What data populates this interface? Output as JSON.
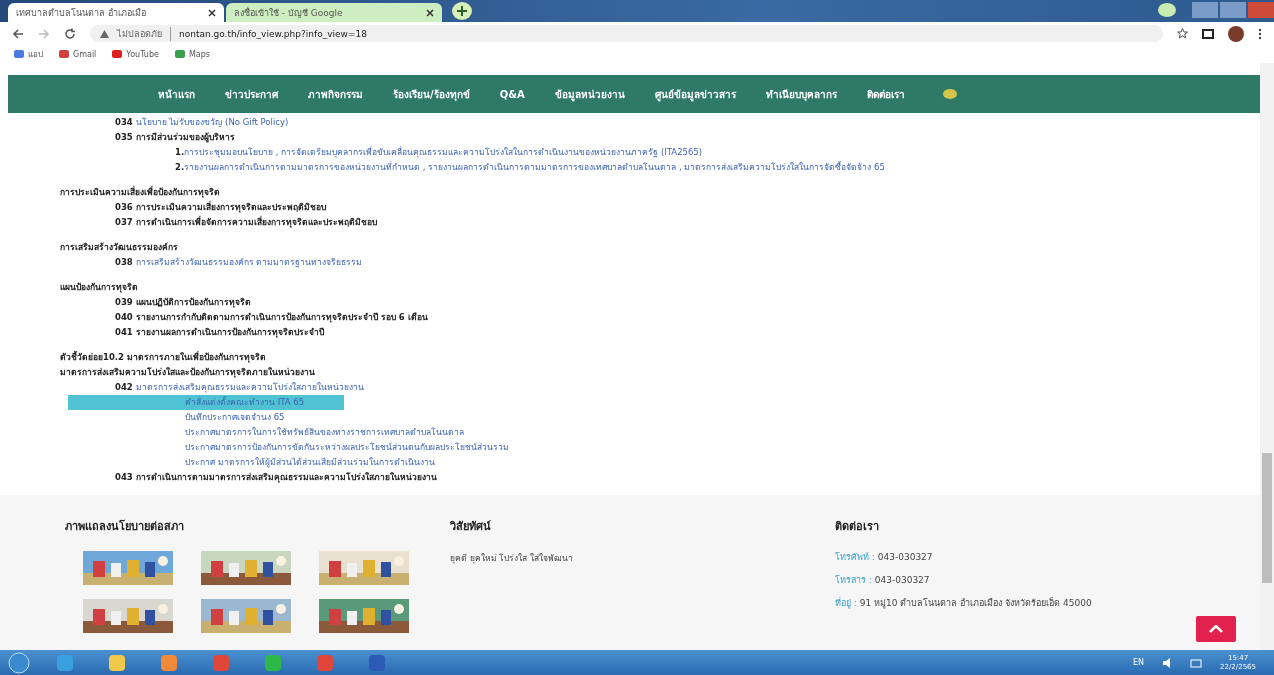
{
  "browser": {
    "tabs": [
      {
        "title": "เทศบาลตำบลโนนตาล อำเภอเมือ",
        "selected": true
      },
      {
        "title": "ลงชื่อเข้าใช้ - บัญชี Google",
        "selected": false
      }
    ],
    "security": "ไม่ปลอดภัย",
    "url": "nontan.go.th/info_view.php?info_view=18",
    "bookmarks": [
      {
        "label": "แอป",
        "kind": "apps"
      },
      {
        "label": "Gmail",
        "kind": "gmail"
      },
      {
        "label": "YouTube",
        "kind": "youtube"
      },
      {
        "label": "Maps",
        "kind": "maps"
      }
    ]
  },
  "nav": [
    "หน้าแรก",
    "ข่าวประกาศ",
    "ภาพกิจกรรม",
    "ร้องเรียน/ร้องทุกข์",
    "Q&A",
    "ข้อมูลหน่วยงาน",
    "ศูนย์ข้อมูลข่าวสาร",
    "ทำเนียบบุคลากร",
    "ติดต่อเรา"
  ],
  "sections": [
    {
      "items": [
        {
          "code": "034",
          "text": "นโยบาย ไม่รับของขวัญ (No Gift Policy)",
          "link": true
        },
        {
          "code": "035",
          "text": "การมีส่วนร่วมของผู้บริหาร",
          "link": false,
          "numbered": [
            {
              "num": "1.",
              "text": "การประชุมมอบนโยบาย , การจัดเตรียมบุคลากรเพื่อขับเคลื่อนคุณธรรมและความโปร่งใสในการดำเนินงานของหน่วยงานภาครัฐ (ITA2565)"
            },
            {
              "num": "2.",
              "text": "รายงานผลการดำเนินการตามมาตรการของหน่วยงานที่กำหนด , รายงานผลการดำเนินการตามมาตรการของเทศบาลตำบลโนนตาล , มาตรการส่งเสริมความโปร่งใสในการจัดซื้อจัดจ้าง 65"
            }
          ]
        }
      ]
    },
    {
      "heading": "การประเมินความเสี่ยงเพื่อป้องกันการทุจริต",
      "items": [
        {
          "code": "036",
          "text": "การประเมินความเสี่ยงการทุจริตและประพฤติมิชอบ",
          "link": false
        },
        {
          "code": "037",
          "text": "การดำเนินการเพื่อจัดการความเสี่ยงการทุจริตและประพฤติมิชอบ",
          "link": false
        }
      ]
    },
    {
      "heading": "การเสริมสร้างวัฒนธรรมองค์กร",
      "items": [
        {
          "code": "038",
          "text": "การเสริมสร้างวัฒนธรรมองค์กร ตามมาตรฐานทางจริยธรรม",
          "link": true
        }
      ]
    },
    {
      "heading": "แผนป้องกันการทุจริต",
      "items": [
        {
          "code": "039",
          "text": "แผนปฏิบัติการป้องกันการทุจริต",
          "link": false
        },
        {
          "code": "040",
          "text": "รายงานการกำกับติดตามการดำเนินการป้องกันการทุจริตประจำปี รอบ 6 เดือน",
          "link": false
        },
        {
          "code": "041",
          "text": "รายงานผลการดำเนินการป้องกันการทุจริตประจำปี",
          "link": false
        }
      ]
    },
    {
      "heading": "ตัวชี้วัดย่อย10.2 มาตรการภายในเพื่อป้องกันการทุจริต",
      "subheading": "มาตรการส่งเสริมความโปร่งใสและป้องกันการทุจริตภายในหน่วยงาน",
      "items": [
        {
          "code": "042",
          "text": "มาตรการส่งเสริมคุณธรรมและความโปร่งใสภายในหน่วยงาน",
          "link": true,
          "links": [
            {
              "text": "คำสั่งแต่งตั้งคณะทำงาน ITA 65",
              "selected": true
            },
            {
              "text": "บันทึกประกาศเจตจำนง 65",
              "selected": false
            },
            {
              "text": "ประกาศมาตรการในการใช้ทรัพย์สินของทางราชการเทศบาลตำบลโนนตาล",
              "selected": false
            },
            {
              "text": "ประกาศมาตรการป้องกันการขัดกันระหว่างผลประโยชน์ส่วนตนกับผลประโยชน์ส่วนรวม",
              "selected": false
            },
            {
              "text": "ประกาศ มาตรการให้ผู้มีส่วนได้ส่วนเสียมีส่วนร่วมในการดำเนินงาน",
              "selected": false
            }
          ]
        },
        {
          "code": "043",
          "text": "การดำเนินการตามมาตรการส่งเสริมคุณธรรมและความโปร่งใสภายในหน่วยงาน",
          "link": false
        }
      ]
    }
  ],
  "footer": {
    "gallery": {
      "title": "ภาพแถลงนโยบายต่อสภา"
    },
    "vision": {
      "title": "วิสัยทัศน์",
      "text": "ยุคดี ยุคใหม่ โปร่งใส ใส่ใจพัฒนา"
    },
    "contact": {
      "title": "ติดต่อเรา",
      "lines": [
        {
          "label": "โทรศัพท์ :",
          "value": "043-030327"
        },
        {
          "label": "โทรสาร :",
          "value": "043-030327"
        },
        {
          "label": "ที่อยู่ :",
          "value": "91 หมู่10 ตำบลโนนตาล อำเภอเมือง จังหวัดร้อยเอ็ด 45000"
        }
      ]
    }
  },
  "taskbar": {
    "apps": [
      {
        "kind": "ie"
      },
      {
        "kind": "folder"
      },
      {
        "kind": "media"
      },
      {
        "kind": "chrome"
      },
      {
        "kind": "line"
      },
      {
        "kind": "chrome"
      },
      {
        "kind": "word"
      }
    ],
    "lang": "EN",
    "time": "15:47",
    "date": "22/2/2565"
  }
}
